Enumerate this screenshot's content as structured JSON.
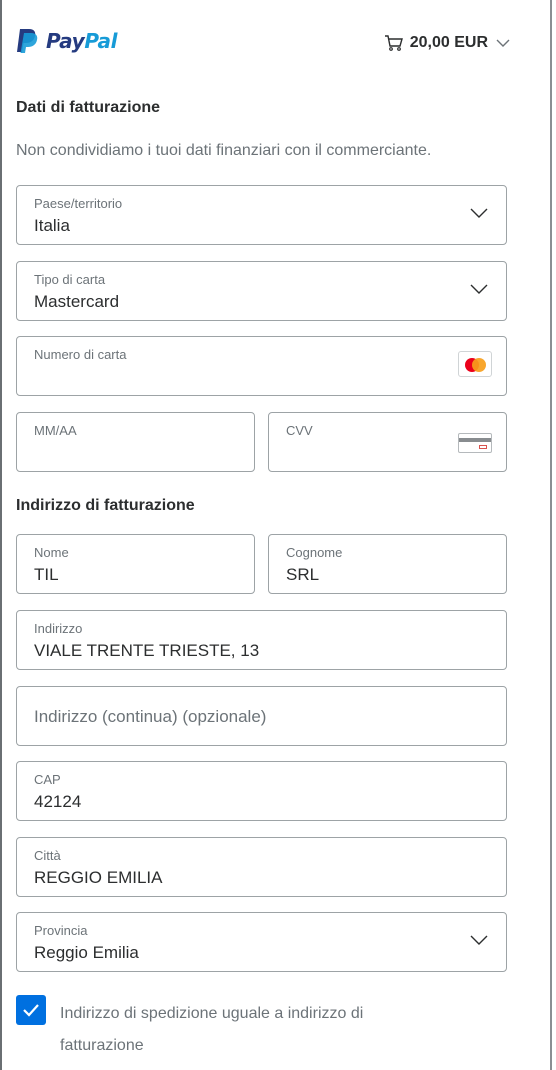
{
  "header": {
    "logo_pay": "Pay",
    "logo_pal": "Pal",
    "cart_total": "20,00 EUR",
    "brand_colors": {
      "pay": "#253b80",
      "pal": "#179bd7"
    }
  },
  "billing": {
    "title": "Dati di fatturazione",
    "note": "Non condividiamo i tuoi dati finanziari con il commerciante.",
    "country": {
      "label": "Paese/territorio",
      "value": "Italia"
    },
    "card_type": {
      "label": "Tipo di carta",
      "value": "Mastercard"
    },
    "card_number": {
      "label": "Numero di carta",
      "value": ""
    },
    "expiry": {
      "label": "MM/AA",
      "value": ""
    },
    "cvv": {
      "label": "CVV",
      "value": ""
    }
  },
  "address": {
    "title": "Indirizzo di fatturazione",
    "first_name": {
      "label": "Nome",
      "value": "TIL"
    },
    "last_name": {
      "label": "Cognome",
      "value": "SRL"
    },
    "street": {
      "label": "Indirizzo",
      "value": "VIALE TRENTE TRIESTE, 13"
    },
    "street2": {
      "placeholder": "Indirizzo (continua) (opzionale)"
    },
    "zip": {
      "label": "CAP",
      "value": "42124"
    },
    "city": {
      "label": "Città",
      "value": "REGGIO EMILIA"
    },
    "province": {
      "label": "Provincia",
      "value": "Reggio Emilia"
    }
  },
  "same_shipping": {
    "checked": true,
    "label": "Indirizzo di spedizione uguale a indirizzo di fatturazione"
  },
  "icons": [
    "paypal-logo-icon",
    "cart-icon",
    "chevron-down-icon",
    "mastercard-icon",
    "cvv-card-icon",
    "checkmark-icon"
  ],
  "colors": {
    "accent": "#0070e0",
    "border": "#9da3a6",
    "muted_text": "#6c7378"
  }
}
